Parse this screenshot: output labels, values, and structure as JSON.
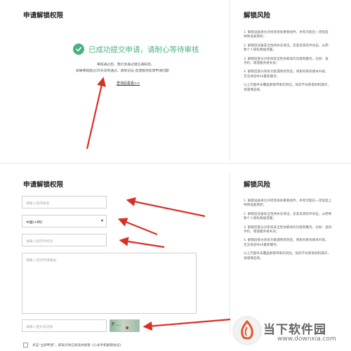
{
  "top": {
    "title": "申请解锁权限",
    "success_message": "已成功提交申请，请耐心等待审核",
    "note_line1": "审核通过后，我们会通过短信通知您。",
    "note_line2": "如果审核超过10天没有通过，请到论坛-反馈版块反馈申请问题",
    "back_link": "查询后看看>>"
  },
  "risk": {
    "title": "解锁风险",
    "lines_top": [
      "1. 解锁设备将允许修改系统重要组件，并有可能在一定程度",
      "导致设备受损；",
      "2. 解锁后设备安全性将失去保证，恶意恶意软件攻击，从而",
      "致个人隐私数据泄露；",
      "3. 解锁后部分对系统安全性依赖高的功能和服务，比如：查",
      "手机、增值服务将失效；",
      "4. 解锁后部分系统功能遇到修改后，将影响系统版本升级，",
      "无法体验MIUI最新服务；",
      "以上内容并未覆盖解锁带来的风险，如您不肯愿意刷机操作，",
      "请谨慎选择。"
    ],
    "lines_bottom": [
      "1. 解锁设备将允许修改系统重要组件，并有可能在一定程度上",
      "导致设备受损；",
      "2. 解锁后设备安全性将失去保证，恶意恶意软件攻击，从而导",
      "致个人隐私数据泄露；",
      "3. 解锁后部分对系统安全性依赖高的功能和服务，比如：查找",
      "手机、增值服务将失效；",
      "4. 解锁后部分系统功能遇到修改后，将影响系统版本升级，",
      "无法体验MIUI最新服务；",
      "以上内容并未覆盖解锁带来的风险，如您不肯愿意刷机操作，",
      "请谨慎选择。"
    ]
  },
  "form": {
    "title": "申请解锁权限",
    "name_placeholder": "请输入您的姓名",
    "country_value": "中国(+86)",
    "phone_placeholder": "请输入您的手机号",
    "reason_placeholder": "请输入您的申请理由",
    "captcha_placeholder": "请输入图片验证码",
    "agreement_text": "点击“立即申请”，即表示你已阅读并接受《小米手机解锁协议》",
    "captcha_text": "P   ..."
  },
  "watermark": {
    "brand": "当下软件园",
    "site": "www.downxia.com"
  },
  "colors": {
    "accent_green": "#4bb27f",
    "arrow_red": "#d93025"
  }
}
